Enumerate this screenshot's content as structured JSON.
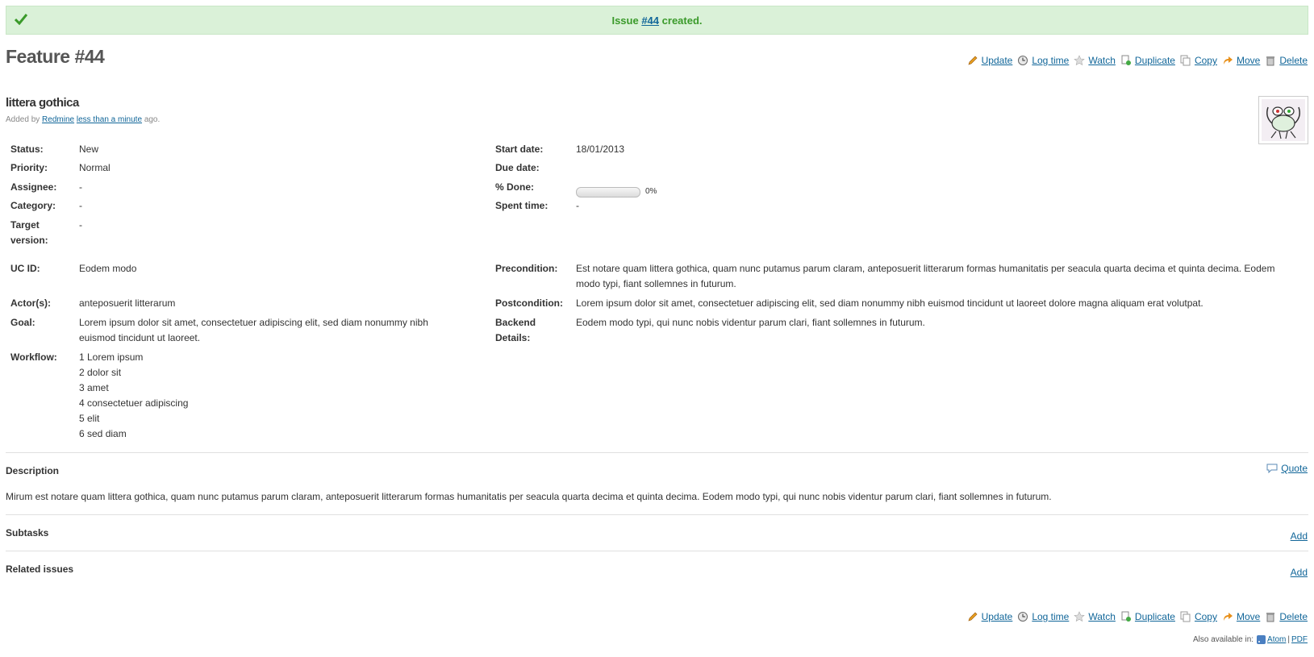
{
  "flash": {
    "prefix": "Issue",
    "issue_link": "#44",
    "suffix": "created."
  },
  "title": "Feature #44",
  "actions": {
    "update": "Update",
    "log_time": "Log time",
    "watch": "Watch",
    "duplicate": "Duplicate",
    "copy": "Copy",
    "move": "Move",
    "delete": "Delete"
  },
  "subject": "littera gothica",
  "author": {
    "added_by": "Added by",
    "user": "Redmine",
    "time": "less than a minute",
    "ago": "ago."
  },
  "attributes": {
    "status": {
      "label": "Status:",
      "value": "New"
    },
    "priority": {
      "label": "Priority:",
      "value": "Normal"
    },
    "assignee": {
      "label": "Assignee:",
      "value": "-"
    },
    "category": {
      "label": "Category:",
      "value": "-"
    },
    "target_version": {
      "label_line1": "Target",
      "label_line2": "version:",
      "value": "-"
    },
    "start_date": {
      "label": "Start date:",
      "value": "18/01/2013"
    },
    "due_date": {
      "label": "Due date:",
      "value": ""
    },
    "done": {
      "label": "% Done:",
      "value": "0%",
      "percent": 0
    },
    "spent_time": {
      "label": "Spent time:",
      "value": "-"
    },
    "uc_id": {
      "label": "UC ID:",
      "value": "Eodem modo"
    },
    "precondition": {
      "label": "Precondition:",
      "line1": "Est notare quam littera gothica, quam nunc putamus parum claram, anteposuerit litterarum formas humanitatis per seacula quarta decima et quinta decima. Eodem",
      "line2": "modo typi, fiant sollemnes in futurum."
    },
    "actors": {
      "label": "Actor(s):",
      "value": "anteposuerit litterarum"
    },
    "postcondition": {
      "label": "Postcondition:",
      "value": "Lorem ipsum dolor sit amet, consectetuer adipiscing elit, sed diam nonummy nibh euismod tincidunt ut laoreet dolore magna aliquam erat volutpat."
    },
    "goal": {
      "label": "Goal:",
      "line1": "Lorem ipsum dolor sit amet, consectetuer adipiscing elit, sed diam nonummy nibh",
      "line2": "euismod tincidunt ut laoreet."
    },
    "backend": {
      "label_line1": "Backend",
      "label_line2": "Details:",
      "value": "Eodem modo typi, qui nunc nobis videntur parum clari, fiant sollemnes in futurum."
    },
    "workflow": {
      "label": "Workflow:",
      "steps": [
        "1 Lorem ipsum",
        "2 dolor sit",
        "3 amet",
        "4 consectetuer adipiscing",
        "5 elit",
        "6 sed diam"
      ]
    }
  },
  "description": {
    "title": "Description",
    "quote": "Quote",
    "text": "Mirum est notare quam littera gothica, quam nunc putamus parum claram, anteposuerit litterarum formas humanitatis per seacula quarta decima et quinta decima. Eodem modo typi, qui nunc nobis videntur parum clari, fiant sollemnes in futurum."
  },
  "subtasks": {
    "title": "Subtasks",
    "add": "Add"
  },
  "related": {
    "title": "Related issues",
    "add": "Add"
  },
  "also_available": {
    "label": "Also available in:",
    "atom": "Atom",
    "separator": "|",
    "pdf": "PDF"
  },
  "colors": {
    "flash_bg": "#daf1d8",
    "flash_text": "#3a9a2a",
    "link": "#169"
  }
}
